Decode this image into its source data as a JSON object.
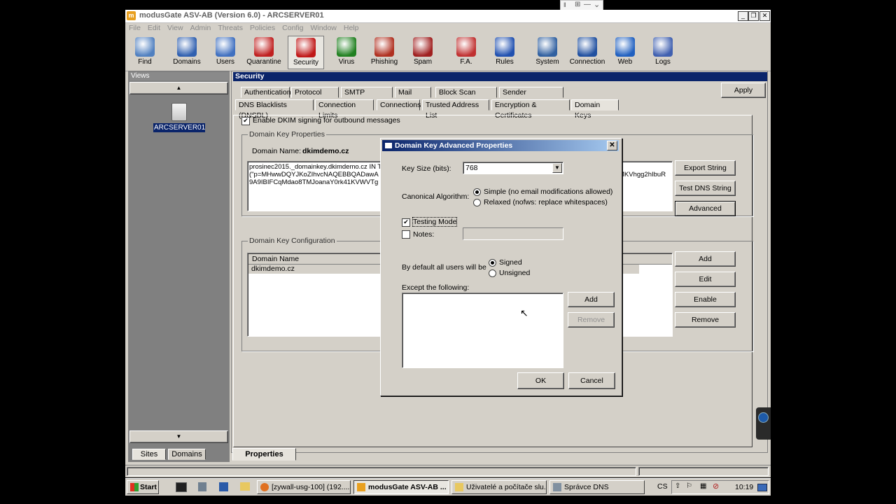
{
  "window": {
    "title": "modusGate ASV-AB (Version 6.0) - ARCSERVER01",
    "icon": "modusgate-app-icon"
  },
  "menu": [
    "File",
    "Edit",
    "View",
    "Admin",
    "Threats",
    "Policies",
    "Config",
    "Window",
    "Help"
  ],
  "toolbar": [
    {
      "label": "Find",
      "icon": "find-icon",
      "color": "#5080c0"
    },
    {
      "label": "Domains",
      "icon": "domains-icon",
      "color": "#3060b0"
    },
    {
      "label": "Users",
      "icon": "users-icon",
      "color": "#4070c0"
    },
    {
      "label": "Quarantine",
      "icon": "quarantine-icon",
      "color": "#c02020"
    },
    {
      "label": "Security",
      "icon": "security-icon",
      "color": "#c01818"
    },
    {
      "label": "Virus",
      "icon": "virus-icon",
      "color": "#208020"
    },
    {
      "label": "Phishing",
      "icon": "phishing-icon",
      "color": "#b03020"
    },
    {
      "label": "Spam",
      "icon": "spam-icon",
      "color": "#a02020"
    },
    {
      "label": "F.A.",
      "icon": "fa-icon",
      "color": "#c03030"
    },
    {
      "label": "Rules",
      "icon": "rules-icon",
      "color": "#2050b0"
    },
    {
      "label": "System",
      "icon": "system-icon",
      "color": "#3060a0"
    },
    {
      "label": "Connection",
      "icon": "connection-icon",
      "color": "#2050a0"
    },
    {
      "label": "Web",
      "icon": "web-icon",
      "color": "#2060c0"
    },
    {
      "label": "Logs",
      "icon": "logs-icon",
      "color": "#4060b0"
    }
  ],
  "views": {
    "header": "Views",
    "server": "ARCSERVER01",
    "tabs": [
      "Sites",
      "Domains"
    ]
  },
  "security": {
    "header": "Security",
    "apply": "Apply",
    "tabs_row1": [
      "Authentication",
      "Protocol Filter",
      "SMTP Security",
      "Mail Relay",
      "Block Scan Attack",
      "Sender Reputation"
    ],
    "tabs_row2": [
      "DNS Blacklists (DNSBL)",
      "Connection Limits",
      "Connections",
      "Trusted Address List",
      "Encryption & Certificates",
      "Domain Keys"
    ],
    "enable_dkim": "Enable DKIM signing for outbound messages",
    "properties_group": "Domain Key Properties",
    "domain_name_label": "Domain Name:",
    "domain_name_value": "dkimdemo.cz",
    "key_text_lines": [
      "prosinec2015._domainkey.dkimdemo.cz IN T",
      "(\"p=MHwwDQYJKoZIhvcNAQEBBQADawA",
      "9A9IBIFCqMdao8TMJoanaY0rk41KVWVTg"
    ],
    "key_text_right": "MKVhgg2hIbuR",
    "btn_export": "Export String",
    "btn_test": "Test DNS String",
    "btn_advanced": "Advanced",
    "config_group": "Domain Key Configuration",
    "col_domain": "Domain Name",
    "row_domain": "dkimdemo.cz",
    "btn_add": "Add",
    "btn_edit": "Edit",
    "btn_enable": "Enable",
    "btn_remove": "Remove",
    "bottom_tab": "Properties"
  },
  "dialog": {
    "title": "Domain Key Advanced Properties",
    "keysize_label": "Key Size (bits):",
    "keysize_value": "768",
    "canon_label": "Canonical Algorithm:",
    "canon_simple": "Simple (no email modifications allowed)",
    "canon_relaxed": "Relaxed (nofws: replace whitespaces)",
    "testing_mode": "Testing Mode",
    "notes": "Notes:",
    "default_label": "By default all users will be",
    "signed": "Signed",
    "unsigned": "Unsigned",
    "except_label": "Except the following:",
    "add": "Add",
    "remove": "Remove",
    "ok": "OK",
    "cancel": "Cancel"
  },
  "taskbar": {
    "start": "Start",
    "tasks": [
      "[zywall-usg-100] (192....",
      "modusGate ASV-AB ...",
      "Uživatelé a počítače slu...",
      "Správce DNS"
    ],
    "lang": "CS",
    "clock": "10:19"
  }
}
